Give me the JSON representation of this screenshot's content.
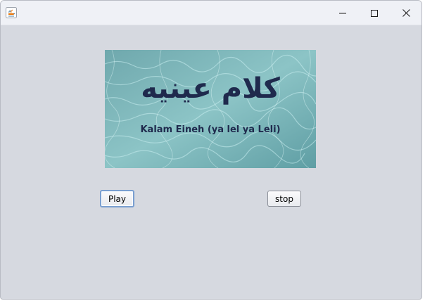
{
  "window": {
    "app_icon": "java-icon",
    "controls": {
      "minimize_icon": "minimize-icon",
      "maximize_icon": "maximize-icon",
      "close_icon": "close-icon"
    }
  },
  "song_image": {
    "arabic_title": "كلام عينيه",
    "latin_title": "Kalam Eineh (ya lel ya Leli)"
  },
  "buttons": {
    "play_label": "Play",
    "stop_label": "stop"
  },
  "colors": {
    "window_background": "#d6d9e0",
    "titlebar_background": "#eff1f6",
    "title_text": "#1f2a4d",
    "focus_border": "#7a9fd0"
  }
}
